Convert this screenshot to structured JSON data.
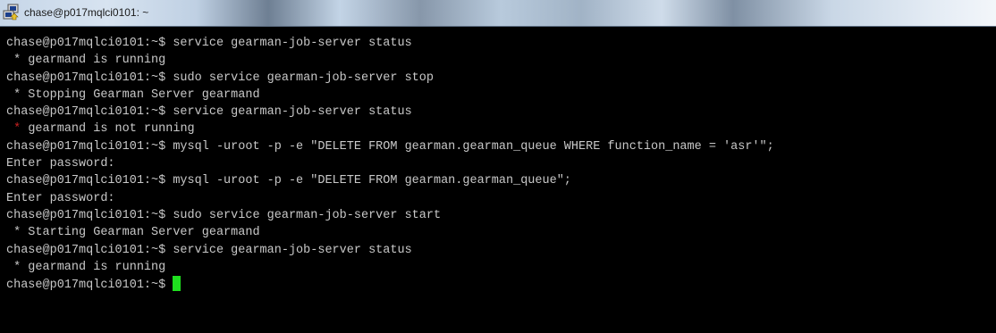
{
  "window": {
    "title": "chase@p017mqlci0101: ~",
    "icon": "putty-icon"
  },
  "terminal": {
    "lines": [
      "chase@p017mqlci0101:~$ service gearman-job-server status",
      " * gearmand is running",
      "chase@p017mqlci0101:~$ sudo service gearman-job-server stop",
      " * Stopping Gearman Server gearmand",
      "chase@p017mqlci0101:~$ service gearman-job-server status",
      "gearmand is not running",
      "chase@p017mqlci0101:~$ mysql -uroot -p -e \"DELETE FROM gearman.gearman_queue WHERE function_name = 'asr'\";",
      "Enter password:",
      "chase@p017mqlci0101:~$ mysql -uroot -p -e \"DELETE FROM gearman.gearman_queue\";",
      "Enter password:",
      "chase@p017mqlci0101:~$ sudo service gearman-job-server start",
      " * Starting Gearman Server gearmand",
      "chase@p017mqlci0101:~$ service gearman-job-server status",
      " * gearmand is running"
    ],
    "prompt": "chase@p017mqlci0101:~$ ",
    "error_bullet": " * ",
    "colors": {
      "background": "#000000",
      "text": "#c8c8c8",
      "error_bullet": "#cc2222",
      "cursor": "#1fe01f"
    }
  }
}
